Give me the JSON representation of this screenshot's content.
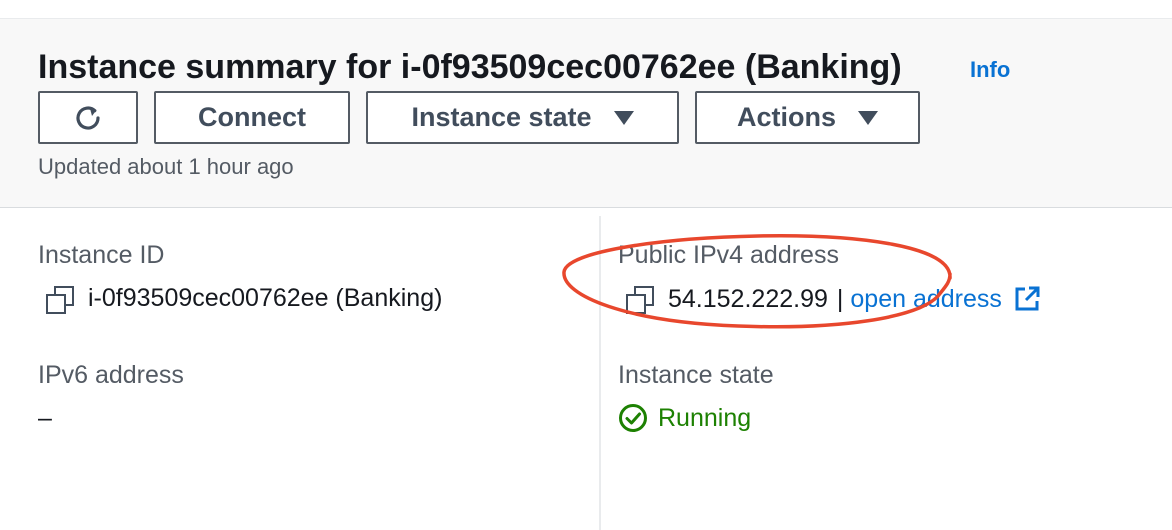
{
  "header": {
    "title": "Instance summary for i-0f93509cec00762ee (Banking)",
    "info_link": "Info",
    "buttons": {
      "refresh_icon": "refresh-icon",
      "connect": "Connect",
      "instance_state": "Instance state",
      "actions": "Actions"
    },
    "updated": "Updated about 1 hour ago"
  },
  "details": {
    "instance_id": {
      "label": "Instance ID",
      "value": "i-0f93509cec00762ee (Banking)"
    },
    "ipv6": {
      "label": "IPv6 address",
      "value": "–"
    },
    "public_ipv4": {
      "label": "Public IPv4 address",
      "value": "54.152.222.99",
      "separator": "|",
      "link": "open address"
    },
    "instance_state": {
      "label": "Instance state",
      "value": "Running"
    }
  },
  "colors": {
    "link": "#0972d3",
    "running": "#1d8102",
    "annotation": "#e8472d"
  }
}
